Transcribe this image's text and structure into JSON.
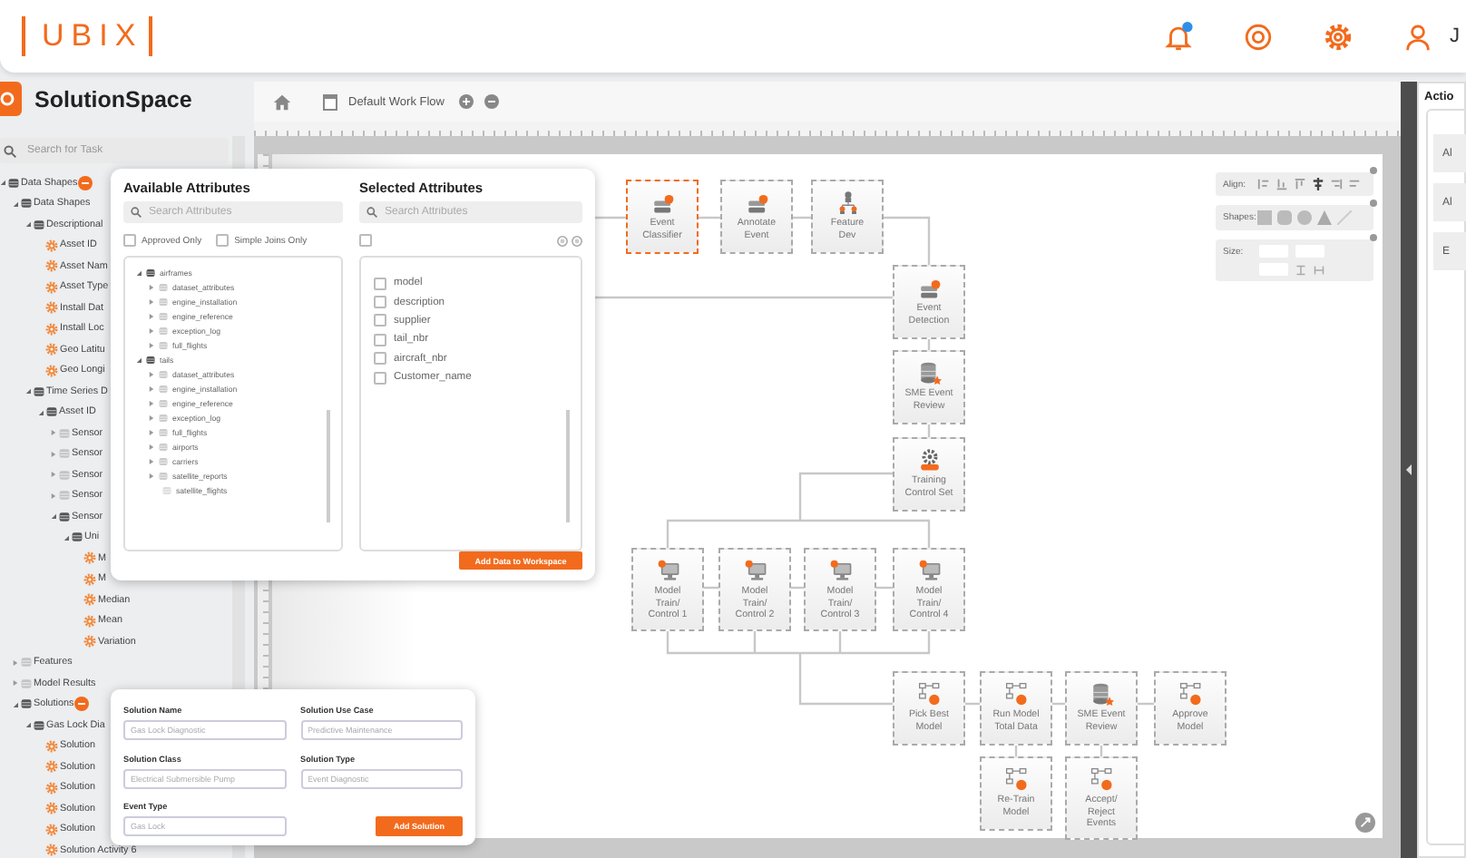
{
  "header": {
    "logo": "UBIX",
    "user_name": "J"
  },
  "sidebar": {
    "title": "SolutionSpace",
    "search": {
      "placeholder": "Search for Task"
    },
    "tree": [
      {
        "label": "Data Shapes",
        "kind": "group",
        "expanded": true,
        "badge": true,
        "children": [
          {
            "label": "Data Shapes",
            "kind": "group",
            "expanded": true,
            "children": [
              {
                "label": "Descriptional",
                "kind": "group",
                "expanded": true,
                "children": [
                  {
                    "label": "Asset ID",
                    "kind": "attribute"
                  },
                  {
                    "label": "Asset Nam",
                    "kind": "attribute"
                  },
                  {
                    "label": "Asset Type",
                    "kind": "attribute"
                  },
                  {
                    "label": "Install Dat",
                    "kind": "attribute"
                  },
                  {
                    "label": "Install Loc",
                    "kind": "attribute"
                  },
                  {
                    "label": "Geo Latitu",
                    "kind": "attribute"
                  },
                  {
                    "label": "Geo Longi",
                    "kind": "attribute"
                  }
                ]
              },
              {
                "label": "Time Series D",
                "kind": "group",
                "expanded": true,
                "children": [
                  {
                    "label": "Asset ID",
                    "kind": "group",
                    "expanded": true,
                    "children": [
                      {
                        "label": "Sensor",
                        "kind": "group",
                        "expanded": false
                      },
                      {
                        "label": "Sensor",
                        "kind": "group",
                        "expanded": false
                      },
                      {
                        "label": "Sensor",
                        "kind": "group",
                        "expanded": false
                      },
                      {
                        "label": "Sensor",
                        "kind": "group",
                        "expanded": false
                      },
                      {
                        "label": "Sensor",
                        "kind": "group",
                        "expanded": true,
                        "children": [
                          {
                            "label": "Uni",
                            "kind": "group",
                            "expanded": true,
                            "children": [
                              {
                                "label": "M",
                                "kind": "attribute"
                              },
                              {
                                "label": "M",
                                "kind": "attribute"
                              },
                              {
                                "label": "Median",
                                "kind": "attribute"
                              },
                              {
                                "label": "Mean",
                                "kind": "attribute"
                              },
                              {
                                "label": "Variation",
                                "kind": "attribute"
                              }
                            ]
                          }
                        ]
                      }
                    ]
                  }
                ]
              }
            ]
          },
          {
            "label": "Features",
            "kind": "group",
            "expanded": false
          },
          {
            "label": "Model Results",
            "kind": "group",
            "expanded": false
          },
          {
            "label": "Solutions",
            "kind": "group",
            "expanded": true,
            "badge": true,
            "children": [
              {
                "label": "Gas Lock Dia",
                "kind": "group",
                "expanded": true,
                "children": [
                  {
                    "label": "Solution",
                    "kind": "attribute"
                  },
                  {
                    "label": "Solution",
                    "kind": "attribute"
                  },
                  {
                    "label": "Solution",
                    "kind": "attribute"
                  },
                  {
                    "label": "Solution",
                    "kind": "attribute"
                  },
                  {
                    "label": "Solution",
                    "kind": "attribute"
                  },
                  {
                    "label": "Solution Activity 6",
                    "kind": "attribute"
                  }
                ]
              }
            ]
          }
        ]
      }
    ]
  },
  "workspace": {
    "workflow_name": "Default Work Flow",
    "tools": {
      "align_label": "Align:",
      "shapes_label": "Shapes:",
      "size_label": "Size:"
    },
    "nodes": [
      {
        "label": "Event\nClassifier",
        "selected": true
      },
      {
        "label": "Annotate\nEvent",
        "selected": false
      },
      {
        "label": "Feature\nDev",
        "selected": false
      },
      {
        "label": "Event\nDetection",
        "selected": false
      },
      {
        "label": "SME Event\nReview",
        "selected": false
      },
      {
        "label": "Training\nControl Set",
        "selected": false
      },
      {
        "label": "Model\nTrain/\nControl 1",
        "selected": false
      },
      {
        "label": "Model\nTrain/\nControl 2",
        "selected": false
      },
      {
        "label": "Model\nTrain/\nControl 3",
        "selected": false
      },
      {
        "label": "Model\nTrain/\nControl 4",
        "selected": false
      },
      {
        "label": "Pick Best\nModel",
        "selected": false
      },
      {
        "label": "Run Model\nTotal Data",
        "selected": false
      },
      {
        "label": "SME Event\nReview",
        "selected": false
      },
      {
        "label": "Approve\nModel",
        "selected": false
      },
      {
        "label": "Re-Train\nModel",
        "selected": false
      },
      {
        "label": "Accept/\nReject\nEvents",
        "selected": false
      }
    ]
  },
  "actions_panel": {
    "title": "Actio",
    "buttons": [
      "Al",
      "Al",
      "E"
    ]
  },
  "attributes_dialog": {
    "available": {
      "title": "Available Attributes",
      "search": {
        "placeholder": "Search Attributes"
      },
      "filters": [
        {
          "label": "Approved Only",
          "checked": false
        },
        {
          "label": "Simple Joins Only",
          "checked": false
        }
      ],
      "tree": [
        {
          "label": "airframes",
          "kind": "group",
          "expanded": true,
          "children": [
            {
              "label": "dataset_attributes",
              "kind": "group",
              "expanded": false
            },
            {
              "label": "engine_installation",
              "kind": "group",
              "expanded": false
            },
            {
              "label": "engine_reference",
              "kind": "group",
              "expanded": false
            },
            {
              "label": "exception_log",
              "kind": "group",
              "expanded": false
            },
            {
              "label": "full_flights",
              "kind": "group",
              "expanded": false
            }
          ]
        },
        {
          "label": "tails",
          "kind": "group",
          "expanded": true,
          "children": [
            {
              "label": "dataset_attributes",
              "kind": "group",
              "expanded": false
            },
            {
              "label": "engine_installation",
              "kind": "group",
              "expanded": false
            },
            {
              "label": "engine_reference",
              "kind": "group",
              "expanded": false
            },
            {
              "label": "exception_log",
              "kind": "group",
              "expanded": false
            },
            {
              "label": "full_flights",
              "kind": "group",
              "expanded": false
            },
            {
              "label": "airports",
              "kind": "group",
              "expanded": false
            },
            {
              "label": "carriers",
              "kind": "group",
              "expanded": false
            },
            {
              "label": "satellite_reports",
              "kind": "group",
              "expanded": false
            },
            {
              "label": "satellite_flights",
              "kind": "leaf"
            }
          ]
        }
      ]
    },
    "selected": {
      "title": "Selected Attributes",
      "search": {
        "placeholder": "Search Attributes"
      },
      "select_all": {
        "checked": false
      },
      "items": [
        {
          "label": "model",
          "checked": false
        },
        {
          "label": "description",
          "checked": false
        },
        {
          "label": "supplier",
          "checked": false
        },
        {
          "label": "tail_nbr",
          "checked": false
        },
        {
          "label": "aircraft_nbr",
          "checked": false
        },
        {
          "label": "Customer_name",
          "checked": false
        }
      ]
    },
    "add_button": "Add Data to Workspace"
  },
  "solution_form": {
    "fields": [
      {
        "label": "Solution Name",
        "placeholder": "Gas Lock Diagnostic"
      },
      {
        "label": "Solution Use Case",
        "placeholder": "Predictive Maintenance"
      },
      {
        "label": "Solution Class",
        "placeholder": "Electrical Submersible Pump"
      },
      {
        "label": "Solution Type",
        "placeholder": "Event Diagnostic"
      },
      {
        "label": "Event Type",
        "placeholder": "Gas Lock"
      }
    ],
    "submit": "Add Solution"
  }
}
